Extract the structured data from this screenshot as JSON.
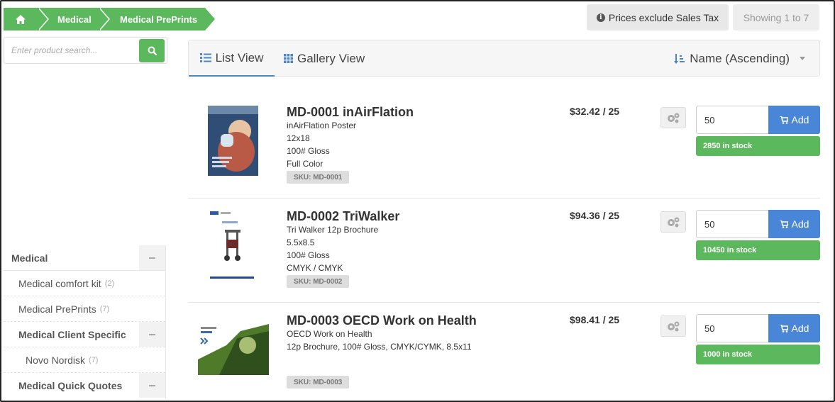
{
  "breadcrumb": {
    "home_icon": "home-icon",
    "items": [
      "Medical",
      "Medical PrePrints"
    ]
  },
  "header": {
    "tax_note": "Prices exclude Sales Tax",
    "info_icon": "info-icon",
    "showing": "Showing 1 to 7"
  },
  "search": {
    "placeholder": "Enter product search...",
    "button_icon": "search-icon"
  },
  "views": {
    "list_label": "List View",
    "gallery_label": "Gallery View",
    "sort_label": "Name (Ascending)",
    "active": "list"
  },
  "categories": [
    {
      "label": "Medical",
      "count": "",
      "level": 0,
      "bold": true,
      "collapsible": true
    },
    {
      "label": "Medical comfort kit",
      "count": "(2)",
      "level": 1,
      "bold": false,
      "collapsible": false
    },
    {
      "label": "Medical PrePrints",
      "count": "(7)",
      "level": 1,
      "bold": false,
      "collapsible": false
    },
    {
      "label": "Medical Client Specific",
      "count": "",
      "level": 1,
      "bold": true,
      "collapsible": true
    },
    {
      "label": "Novo Nordisk",
      "count": "(7)",
      "level": 2,
      "bold": false,
      "collapsible": false
    },
    {
      "label": "Medical Quick Quotes",
      "count": "",
      "level": 1,
      "bold": true,
      "collapsible": true
    }
  ],
  "products": [
    {
      "title": "MD-0001 inAirFlation",
      "details": [
        "inAirFlation Poster",
        "12x18",
        "100# Gloss",
        "Full Color"
      ],
      "sku": "SKU: MD-0001",
      "price": "$32.42 / 25",
      "qty": "50",
      "add_label": "Add",
      "stock": "2850 in stock"
    },
    {
      "title": "MD-0002 TriWalker",
      "details": [
        "Tri Walker 12p Brochure",
        "5.5x8.5",
        "100# Gloss",
        "CMYK / CMYK"
      ],
      "sku": "SKU: MD-0002",
      "price": "$94.36 / 25",
      "qty": "50",
      "add_label": "Add",
      "stock": "10450 in stock"
    },
    {
      "title": "MD-0003 OECD Work on Health",
      "details": [
        "OECD Work on Health",
        "12p Brochure, 100# Gloss, CMYK/CYMK, 8.5x11"
      ],
      "sku": "SKU: MD-0003",
      "price": "$98.41 / 25",
      "qty": "50",
      "add_label": "Add",
      "stock": "1000 in stock"
    }
  ],
  "colors": {
    "accent_green": "#5cb85c",
    "accent_blue": "#4a86d8"
  }
}
